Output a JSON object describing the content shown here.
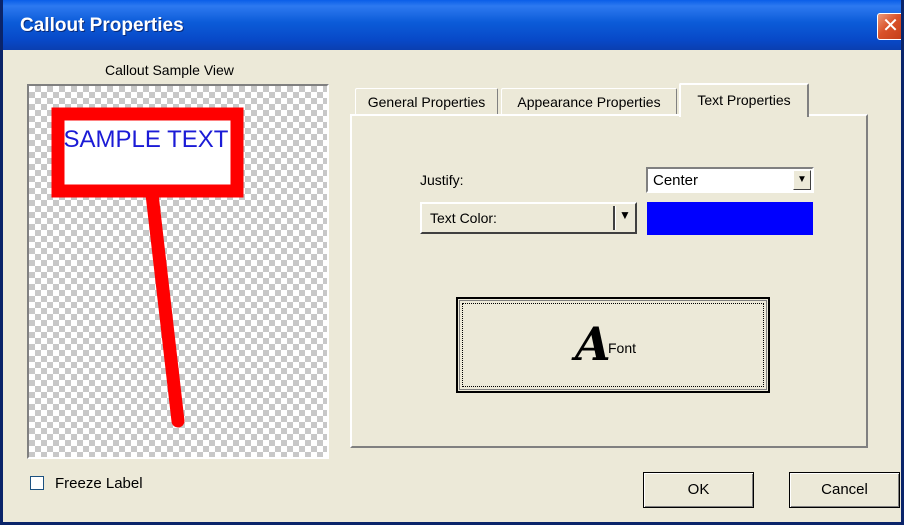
{
  "window": {
    "title": "Callout Properties",
    "close_glyph": "✕"
  },
  "sample": {
    "label": "Callout Sample View",
    "callout_text": "SAMPLE TEXT",
    "callout_text_color": "#1b1bd6",
    "callout_border_color": "#ff0000"
  },
  "freeze": {
    "label": "Freeze Label",
    "checked": false
  },
  "tabs": [
    {
      "label": "General Properties",
      "active": false
    },
    {
      "label": "Appearance Properties",
      "active": false
    },
    {
      "label": "Text Properties",
      "active": true
    }
  ],
  "text_properties": {
    "justify_label": "Justify:",
    "justify_value": "Center",
    "text_color_label": "Text Color:",
    "text_color_value": "#0000ff",
    "font_button_glyph": "A",
    "font_button_label": "Font"
  },
  "buttons": {
    "ok": "OK",
    "cancel": "Cancel"
  },
  "icons": {
    "dropdown": "▼",
    "close": "close-icon"
  }
}
